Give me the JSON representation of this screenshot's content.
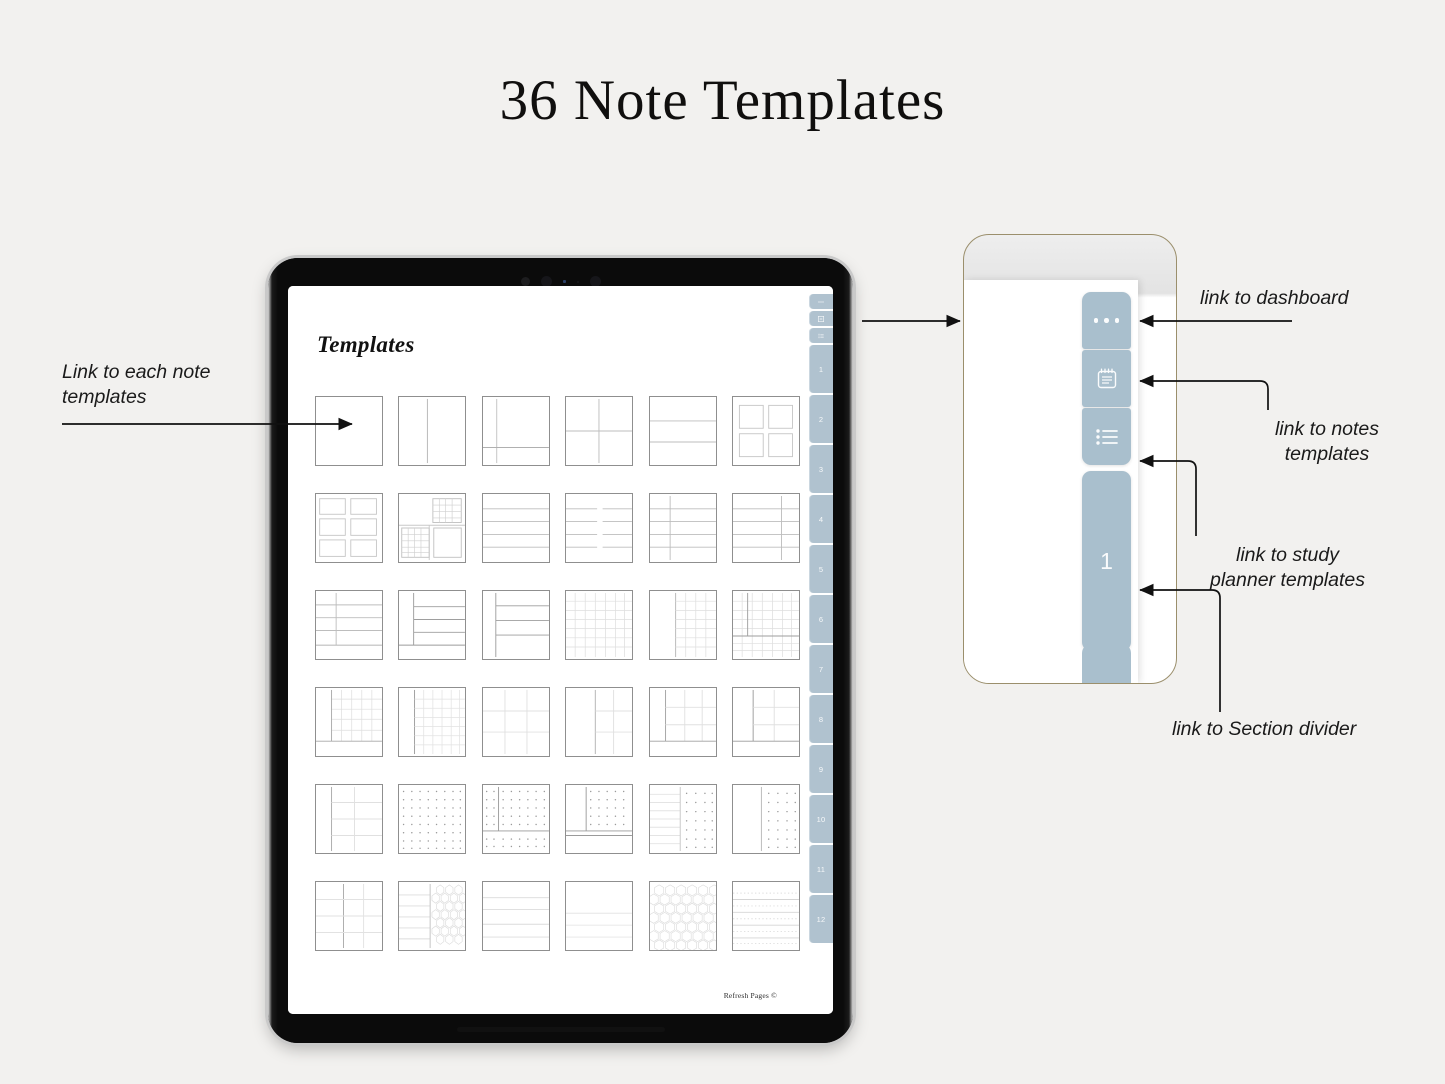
{
  "page": {
    "title": "36 Note  Templates",
    "background_color": "#f2f1ef"
  },
  "annotations": [
    {
      "id": "left",
      "text": "Link to each note\ntemplates"
    },
    {
      "id": "dashboard",
      "text": "link to dashboard"
    },
    {
      "id": "notes",
      "text": "link to notes\ntemplates"
    },
    {
      "id": "study",
      "text": "link to study\nplanner templates"
    },
    {
      "id": "divider",
      "text": "link to Section divider"
    }
  ],
  "tablet": {
    "note_page": {
      "heading": "Templates",
      "footer_credit": "Refresh Pages ©",
      "template_count": 36,
      "rows": [
        [
          "blank",
          "two-column",
          "sidebar-left-footer",
          "quadrant",
          "three-rows-wide",
          "four-boxes"
        ],
        [
          "six-boxes",
          "mixed-grid-blocks",
          "five-lines",
          "split-lines",
          "lines-left-column",
          "lines-right-column"
        ],
        [
          "left-col-lines-footer",
          "left-col-lines-wide",
          "narrow-col-lines",
          "full-small-grid",
          "half-blank-half-grid",
          "grid-with-divider"
        ],
        [
          "left-col-grid-footer",
          "narrow-col-grid",
          "wide-grid",
          "half-blank-wide-grid",
          "two-col-grid-footer",
          "col-grid-footer"
        ],
        [
          "three-col-grid",
          "full-dot-grid",
          "dot-grid-split-footer",
          "dot-grid-with-sidebar",
          "lines-and-dots",
          "blank-and-dots"
        ],
        [
          "three-col-light-grid",
          "lines-and-hexagons",
          "wide-lines",
          "sparse-lines",
          "full-hexagons",
          "dashed-lines"
        ]
      ],
      "tabstrip": {
        "icon_tabs": [
          "more-dots-icon",
          "notepad-icon",
          "list-icon"
        ],
        "number_tabs": [
          "1",
          "2",
          "3",
          "4",
          "5",
          "6",
          "7",
          "8",
          "9",
          "10",
          "11",
          "12"
        ],
        "tab_color": "#b0c2cf"
      }
    }
  },
  "zoom_card": {
    "border_color": "#9b8f6c",
    "tab_color": "#a9bfcd",
    "tabs": [
      {
        "id": "dashboard",
        "icon": "more-dots-icon",
        "label": ""
      },
      {
        "id": "notes",
        "icon": "notepad-icon",
        "label": ""
      },
      {
        "id": "study",
        "icon": "list-icon",
        "label": ""
      },
      {
        "id": "divider",
        "icon": "",
        "label": "1"
      }
    ]
  }
}
